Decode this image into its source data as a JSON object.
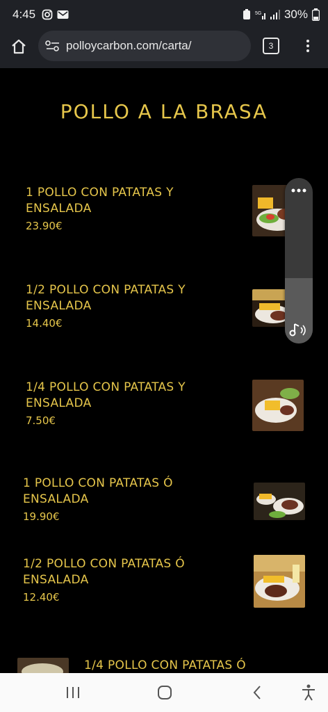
{
  "status_bar": {
    "time": "4:45",
    "battery": "30%"
  },
  "browser": {
    "url": "polloycarbon.com/carta/",
    "tab_count": "3"
  },
  "section": {
    "title": "POLLO A LA BRASA"
  },
  "items": [
    {
      "name_line1": "1 POLLO CON PATATAS Y",
      "name_line2": "ENSALADA",
      "price": "23.90€"
    },
    {
      "name_line1": "1/2 POLLO CON PATATAS Y",
      "name_line2": "ENSALADA",
      "price": "14.40€"
    },
    {
      "name_line1": "1/4 POLLO CON PATATAS Y",
      "name_line2": "ENSALADA",
      "price": "7.50€"
    },
    {
      "name_line1": "1 POLLO CON PATATAS Ó",
      "name_line2": "ENSALADA",
      "price": "19.90€"
    },
    {
      "name_line1": "1/2 POLLO CON PATATAS Ó",
      "name_line2": "ENSALADA",
      "price": "12.40€"
    },
    {
      "name_line1": "1/4 POLLO CON PATATAS Ó"
    }
  ],
  "colors": {
    "accent": "#e6c64b",
    "background": "#000000",
    "chrome": "#1f2126"
  },
  "icons": [
    "home-icon",
    "site-settings-icon",
    "tabs-icon",
    "more-vert-icon",
    "more-horiz-icon",
    "read-aloud-icon",
    "recents-icon",
    "home-nav-icon",
    "back-icon",
    "accessibility-icon"
  ]
}
